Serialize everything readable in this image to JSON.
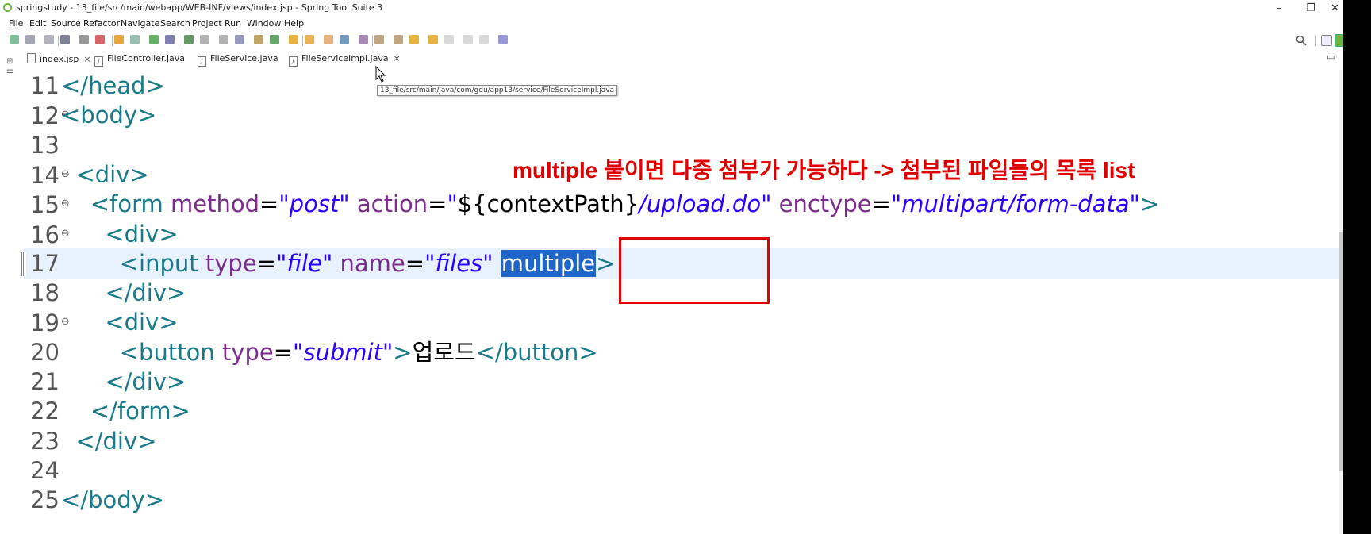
{
  "window": {
    "title": "springstudy - 13_file/src/main/webapp/WEB-INF/views/index.jsp - Spring Tool Suite 3",
    "minimize": "–",
    "restore": "❐",
    "close": "✕"
  },
  "menu": [
    "File",
    "Edit",
    "Source",
    "Refactor",
    "Navigate",
    "Search",
    "Project",
    "Run",
    "Window",
    "Help"
  ],
  "tabs": [
    {
      "label": "index.jsp",
      "active": true,
      "closable": true,
      "icon": "jsp-file-icon"
    },
    {
      "label": "FileController.java",
      "active": false,
      "closable": false,
      "icon": "java-file-icon"
    },
    {
      "label": "FileService.java",
      "active": false,
      "closable": false,
      "icon": "java-file-icon"
    },
    {
      "label": "FileServiceImpl.java",
      "active": false,
      "closable": true,
      "icon": "java-file-icon"
    }
  ],
  "tooltip": "13_file/src/main/java/com/gdu/app13/service/FileServiceImpl.java",
  "annotation": "multiple 붙이면 다중 첨부가 가능하다 -> 첨부된 파일들의 목록 list",
  "editor": {
    "current_line": "17",
    "lines": [
      {
        "num": "11",
        "fold": "",
        "tokens": [
          {
            "t": "tag",
            "v": "</head>"
          }
        ]
      },
      {
        "num": "12",
        "fold": "⊖",
        "tokens": [
          {
            "t": "tag",
            "v": "<body>"
          }
        ]
      },
      {
        "num": "13",
        "fold": "",
        "tokens": []
      },
      {
        "num": "14",
        "fold": "⊖",
        "tokens": [
          {
            "t": "txt",
            "v": "  "
          },
          {
            "t": "tag",
            "v": "<div>"
          }
        ]
      },
      {
        "num": "15",
        "fold": "⊖",
        "tokens": [
          {
            "t": "txt",
            "v": "    "
          },
          {
            "t": "tag",
            "v": "<form "
          },
          {
            "t": "attr",
            "v": "method"
          },
          {
            "t": "txt",
            "v": "="
          },
          {
            "t": "str",
            "v": "\"post\""
          },
          {
            "t": "txt",
            "v": " "
          },
          {
            "t": "attr",
            "v": "action"
          },
          {
            "t": "txt",
            "v": "="
          },
          {
            "t": "str",
            "v": "\""
          },
          {
            "t": "txt",
            "v": "${contextPath}"
          },
          {
            "t": "str",
            "v": "/upload.do\""
          },
          {
            "t": "txt",
            "v": " "
          },
          {
            "t": "attr",
            "v": "enctype"
          },
          {
            "t": "txt",
            "v": "="
          },
          {
            "t": "str",
            "v": "\"multipart/form-data\""
          },
          {
            "t": "tag",
            "v": ">"
          }
        ]
      },
      {
        "num": "16",
        "fold": "⊖",
        "tokens": [
          {
            "t": "txt",
            "v": "      "
          },
          {
            "t": "tag",
            "v": "<div>"
          }
        ]
      },
      {
        "num": "17",
        "fold": "",
        "tokens": [
          {
            "t": "txt",
            "v": "        "
          },
          {
            "t": "tag",
            "v": "<input "
          },
          {
            "t": "attr",
            "v": "type"
          },
          {
            "t": "txt",
            "v": "="
          },
          {
            "t": "str",
            "v": "\"file\""
          },
          {
            "t": "txt",
            "v": " "
          },
          {
            "t": "attr",
            "v": "name"
          },
          {
            "t": "txt",
            "v": "="
          },
          {
            "t": "str",
            "v": "\"files\""
          },
          {
            "t": "txt",
            "v": " "
          },
          {
            "t": "sel",
            "v": "multiple"
          },
          {
            "t": "tag",
            "v": ">"
          }
        ]
      },
      {
        "num": "18",
        "fold": "",
        "tokens": [
          {
            "t": "txt",
            "v": "      "
          },
          {
            "t": "tag",
            "v": "</div>"
          }
        ]
      },
      {
        "num": "19",
        "fold": "⊖",
        "tokens": [
          {
            "t": "txt",
            "v": "      "
          },
          {
            "t": "tag",
            "v": "<div>"
          }
        ]
      },
      {
        "num": "20",
        "fold": "",
        "tokens": [
          {
            "t": "txt",
            "v": "        "
          },
          {
            "t": "tag",
            "v": "<button "
          },
          {
            "t": "attr",
            "v": "type"
          },
          {
            "t": "txt",
            "v": "="
          },
          {
            "t": "str",
            "v": "\"submit\""
          },
          {
            "t": "tag",
            "v": ">"
          },
          {
            "t": "txt",
            "v": "업로드"
          },
          {
            "t": "tag",
            "v": "</button>"
          }
        ]
      },
      {
        "num": "21",
        "fold": "",
        "tokens": [
          {
            "t": "txt",
            "v": "      "
          },
          {
            "t": "tag",
            "v": "</div>"
          }
        ]
      },
      {
        "num": "22",
        "fold": "",
        "tokens": [
          {
            "t": "txt",
            "v": "    "
          },
          {
            "t": "tag",
            "v": "</form>"
          }
        ]
      },
      {
        "num": "23",
        "fold": "",
        "tokens": [
          {
            "t": "txt",
            "v": "  "
          },
          {
            "t": "tag",
            "v": "</div>"
          }
        ]
      },
      {
        "num": "24",
        "fold": "",
        "tokens": []
      },
      {
        "num": "25",
        "fold": "",
        "tokens": [
          {
            "t": "tag",
            "v": "</body>"
          }
        ]
      }
    ]
  },
  "colors": {
    "tag": "#1a7a8a",
    "attr": "#7b2c8c",
    "string": "#2a00ff",
    "selection": "#1f66c8",
    "current_line": "#e8f2fe",
    "annotation": "#e00000"
  },
  "icons": {
    "search": "search-icon",
    "perspective": "open-perspective-icon",
    "spring": "spring-perspective-icon"
  }
}
